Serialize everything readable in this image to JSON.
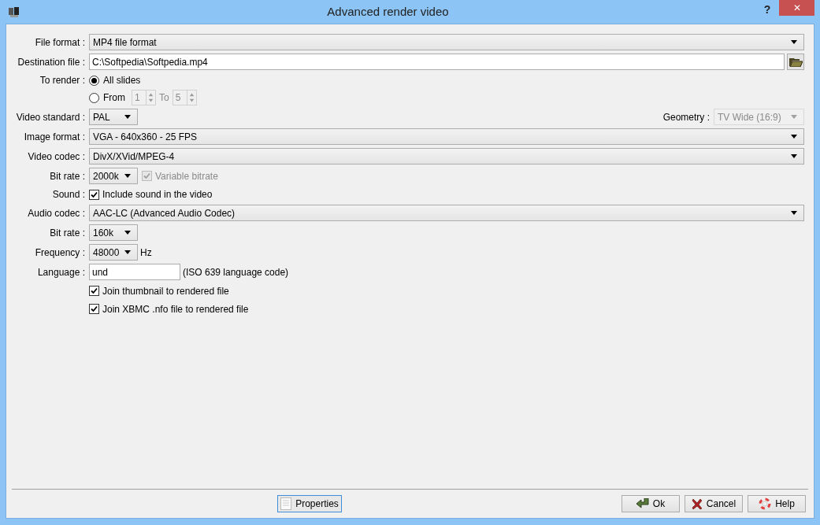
{
  "window": {
    "title": "Advanced render video",
    "help": "?",
    "close": "✕"
  },
  "file_format": {
    "label": "File format :",
    "value": "MP4 file format"
  },
  "destination": {
    "label": "Destination file :",
    "value": "C:\\Softpedia\\Softpedia.mp4"
  },
  "to_render": {
    "label": "To render :",
    "options": [
      {
        "label": "All slides",
        "selected": true
      },
      {
        "label": "From",
        "selected": false
      }
    ],
    "from": "1",
    "to_label": "To",
    "to": "5",
    "disabled": true
  },
  "video_standard": {
    "label": "Video standard :",
    "value": "PAL"
  },
  "geometry": {
    "label": "Geometry :",
    "value": "TV Wide (16:9)",
    "disabled": true
  },
  "image_format": {
    "label": "Image format :",
    "value": "VGA - 640x360 - 25 FPS"
  },
  "video_codec": {
    "label": "Video codec :",
    "value": "DivX/XVid/MPEG-4"
  },
  "video_bit_rate": {
    "label": "Bit rate :",
    "value": "2000k",
    "checkbox": {
      "label": "Variable bitrate",
      "checked": true,
      "disabled": true
    }
  },
  "sound": {
    "label": "Sound :",
    "checkbox": {
      "label": "Include sound in the video",
      "checked": true,
      "disabled": false
    }
  },
  "audio_codec": {
    "label": "Audio codec :",
    "value": "AAC-LC (Advanced Audio Codec)"
  },
  "audio_bit_rate": {
    "label": "Bit rate :",
    "value": "160k"
  },
  "frequency": {
    "label": "Frequency :",
    "value": "48000",
    "unit": "Hz"
  },
  "language": {
    "label": "Language :",
    "value": "und",
    "hint": "(ISO 639 language code)"
  },
  "extra_checks": [
    {
      "label": "Join thumbnail to rendered file",
      "checked": true
    },
    {
      "label": "Join XBMC .nfo file to rendered file",
      "checked": true
    }
  ],
  "buttons": {
    "properties": "Properties",
    "ok": "Ok",
    "cancel": "Cancel",
    "help": "Help"
  }
}
